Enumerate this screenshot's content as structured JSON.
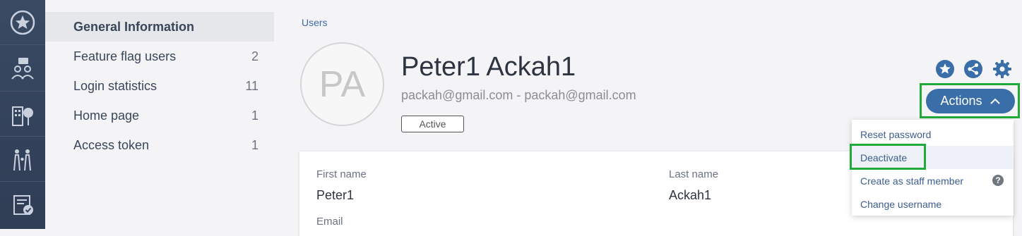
{
  "sidebar": {
    "items": [
      {
        "label": "General Information",
        "count": ""
      },
      {
        "label": "Feature flag users",
        "count": "2"
      },
      {
        "label": "Login statistics",
        "count": "11"
      },
      {
        "label": "Home page",
        "count": "1"
      },
      {
        "label": "Access token",
        "count": "1"
      }
    ]
  },
  "breadcrumb": "Users",
  "profile": {
    "initials": "PA",
    "name": "Peter1 Ackah1",
    "emails": "packah@gmail.com - packah@gmail.com",
    "status": "Active"
  },
  "actions": {
    "label": "Actions",
    "menu": [
      "Reset password",
      "Deactivate",
      "Create as staff member",
      "Change username"
    ],
    "help_glyph": "?"
  },
  "details": {
    "first_name_label": "First name",
    "first_name": "Peter1",
    "last_name_label": "Last name",
    "last_name": "Ackah1",
    "email_label": "Email"
  },
  "icons": [
    "star-icon",
    "people-icon",
    "buildings-icon",
    "family-icon",
    "checklist-icon",
    "favorite-star-icon",
    "share-icon",
    "gear-icon",
    "chevron-up-icon"
  ],
  "colors": {
    "rail": "#34425b",
    "accent": "#3a6ea8",
    "highlight": "#1faa3a"
  }
}
